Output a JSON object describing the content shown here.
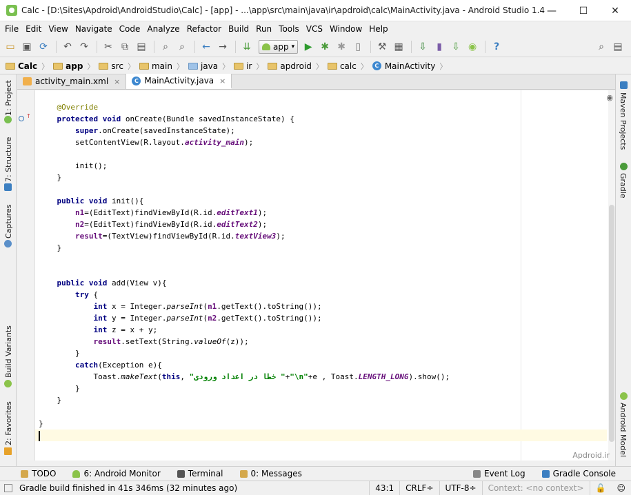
{
  "window": {
    "title": "Calc - [D:\\Sites\\Apdroid\\AndroidStudio\\Calc] - [app] - ...\\app\\src\\main\\java\\ir\\apdroid\\calc\\MainActivity.java - Android Studio 1.4",
    "minimize": "—",
    "maximize": "☐",
    "close": "✕"
  },
  "menu": [
    "File",
    "Edit",
    "View",
    "Navigate",
    "Code",
    "Analyze",
    "Refactor",
    "Build",
    "Run",
    "Tools",
    "VCS",
    "Window",
    "Help"
  ],
  "toolbar": {
    "run_config": "app",
    "run_config_arrow": "▾"
  },
  "breadcrumb": [
    "Calc",
    "app",
    "src",
    "main",
    "java",
    "ir",
    "apdroid",
    "calc",
    "MainActivity"
  ],
  "left_tools": [
    "1: Project",
    "7: Structure",
    "Captures",
    "Build Variants",
    "2: Favorites"
  ],
  "right_tools": [
    "Maven Projects",
    "Gradle",
    "Android Model"
  ],
  "tabs": [
    {
      "label": "activity_main.xml",
      "close": "×"
    },
    {
      "label": "MainActivity.java",
      "close": "×"
    }
  ],
  "editor": {
    "watermark": "Apdroid.ir",
    "code": {
      "l1_ann": "@Override",
      "l2_kw1": "protected",
      "l2_kw2": "void",
      "l2_rest": " onCreate(Bundle savedInstanceState) {",
      "l3_kw": "super",
      "l3_rest": ".onCreate(savedInstanceState);",
      "l4_a": "setContentView(R.layout.",
      "l4_f": "activity_main",
      "l4_b": ");",
      "l6": "init();",
      "l7": "}",
      "l9_kw1": "public",
      "l9_kw2": "void",
      "l9_rest": " init(){",
      "l10_f": "n1",
      "l10_a": "=(EditText)findViewById(R.id.",
      "l10_s": "editText1",
      "l10_b": ");",
      "l11_f": "n2",
      "l11_a": "=(EditText)findViewById(R.id.",
      "l11_s": "editText2",
      "l11_b": ");",
      "l12_f": "result",
      "l12_a": "=(TextView)findViewById(R.id.",
      "l12_s": "textView3",
      "l12_b": ");",
      "l13": "}",
      "l16_kw1": "public",
      "l16_kw2": "void",
      "l16_rest": " add(View v){",
      "l17_kw": "try",
      "l17_rest": " {",
      "l18_kw": "int",
      "l18_a": " x = Integer.",
      "l18_m": "parseInt",
      "l18_b": "(",
      "l18_f": "n1",
      "l18_c": ".getText().toString());",
      "l19_kw": "int",
      "l19_a": " y = Integer.",
      "l19_m": "parseInt",
      "l19_b": "(",
      "l19_f": "n2",
      "l19_c": ".getText().toString());",
      "l20_kw": "int",
      "l20_rest": " z = x + y;",
      "l21_f": "result",
      "l21_a": ".setText(String.",
      "l21_m": "valueOf",
      "l21_b": "(z));",
      "l22": "}",
      "l23_kw": "catch",
      "l23_rest": "(Exception e){",
      "l24_a": "Toast.",
      "l24_m": "makeText",
      "l24_b": "(",
      "l24_kw": "this",
      "l24_c": ", ",
      "l24_s1": "\" خطا در اعداد ورودی\"",
      "l24_d": "+",
      "l24_s2": "\"\\n\"",
      "l24_e": "+e , Toast.",
      "l24_sf": "LENGTH_LONG",
      "l24_g": ").show();",
      "l25": "}",
      "l26": "}",
      "l28": "}"
    }
  },
  "bottom_tools": [
    {
      "label": "TODO"
    },
    {
      "label": "6: Android Monitor"
    },
    {
      "label": "Terminal"
    },
    {
      "label": "0: Messages"
    }
  ],
  "bottom_tools_right": [
    {
      "label": "Event Log"
    },
    {
      "label": "Gradle Console"
    }
  ],
  "status": {
    "message": "Gradle build finished in 41s 346ms (32 minutes ago)",
    "position": "43:1",
    "line_sep": "CRLF÷",
    "encoding": "UTF-8÷",
    "context": "Context: <no context>"
  },
  "colors": {
    "keyword": "#000080",
    "annotation": "#808000",
    "field": "#660e7a",
    "string": "#008000",
    "current_line": "#fffae3"
  }
}
